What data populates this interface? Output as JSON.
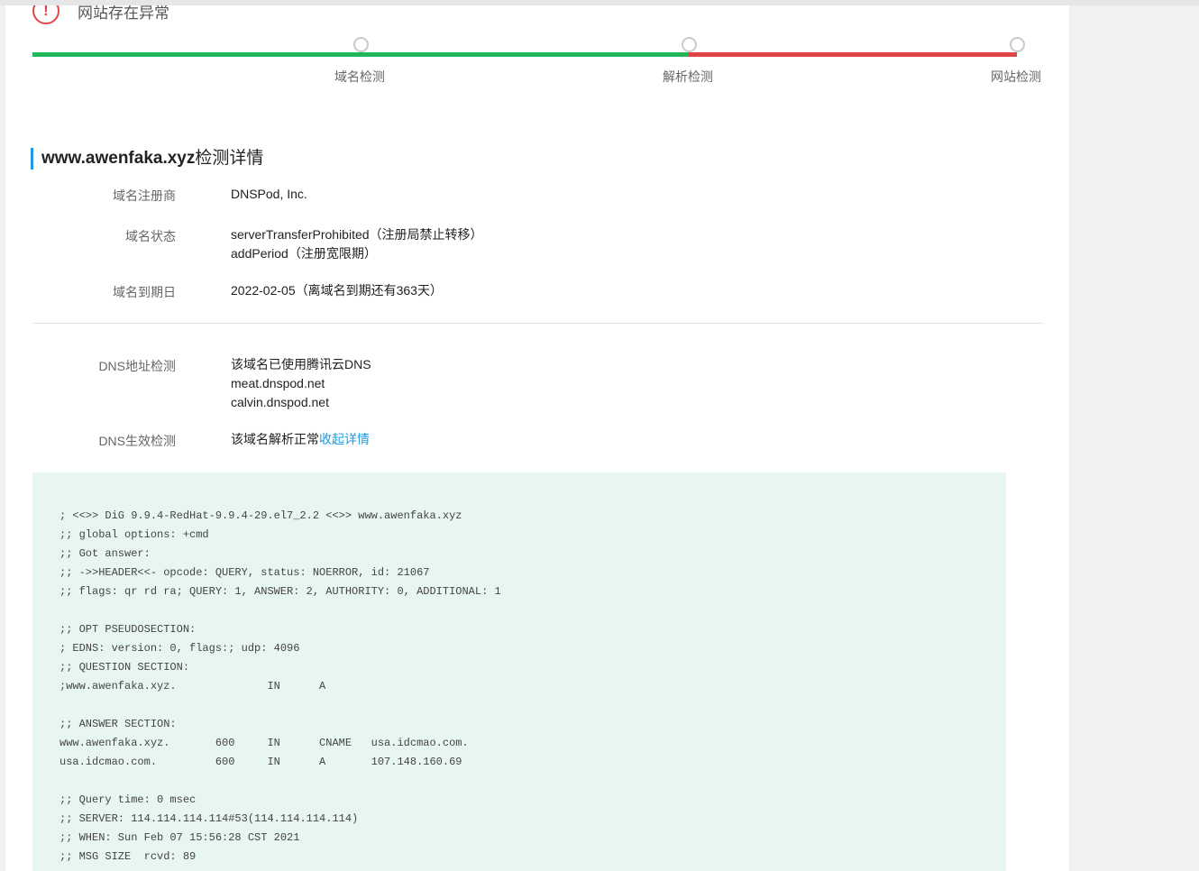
{
  "status": {
    "icon": "exclamation-circle-icon",
    "text": "网站存在异常"
  },
  "progress": {
    "steps": [
      {
        "label": "域名检测",
        "state": "ok"
      },
      {
        "label": "解析检测",
        "state": "ok"
      },
      {
        "label": "网站检测",
        "state": "error"
      }
    ],
    "colors": {
      "ok": "#1fb75a",
      "error": "#e04444"
    }
  },
  "detail": {
    "domain": "www.awenfaka.xyz",
    "title_suffix": "检测详情",
    "registrar_label": "域名注册商",
    "registrar_value": "DNSPod, Inc.",
    "status_label": "域名状态",
    "status_values": [
      "serverTransferProhibited（注册局禁止转移）",
      "addPeriod（注册宽限期）"
    ],
    "expiry_label": "域名到期日",
    "expiry_value": "2022-02-05（离域名到期还有363天）",
    "dns_addr_label": "DNS地址检测",
    "dns_addr_values": [
      "该域名已使用腾讯云DNS",
      "meat.dnspod.net",
      "calvin.dnspod.net"
    ],
    "dns_effect_label": "DNS生效检测",
    "dns_effect_value": "该域名解析正常",
    "dns_effect_link": "收起详情"
  },
  "dig_output": "; <<>> DiG 9.9.4-RedHat-9.9.4-29.el7_2.2 <<>> www.awenfaka.xyz\n;; global options: +cmd\n;; Got answer:\n;; ->>HEADER<<- opcode: QUERY, status: NOERROR, id: 21067\n;; flags: qr rd ra; QUERY: 1, ANSWER: 2, AUTHORITY: 0, ADDITIONAL: 1\n\n;; OPT PSEUDOSECTION:\n; EDNS: version: 0, flags:; udp: 4096\n;; QUESTION SECTION:\n;www.awenfaka.xyz.              IN      A\n\n;; ANSWER SECTION:\nwww.awenfaka.xyz.       600     IN      CNAME   usa.idcmao.com.\nusa.idcmao.com.         600     IN      A       107.148.160.69\n\n;; Query time: 0 msec\n;; SERVER: 114.114.114.114#53(114.114.114.114)\n;; WHEN: Sun Feb 07 15:56:28 CST 2021\n;; MSG SIZE  rcvd: 89"
}
